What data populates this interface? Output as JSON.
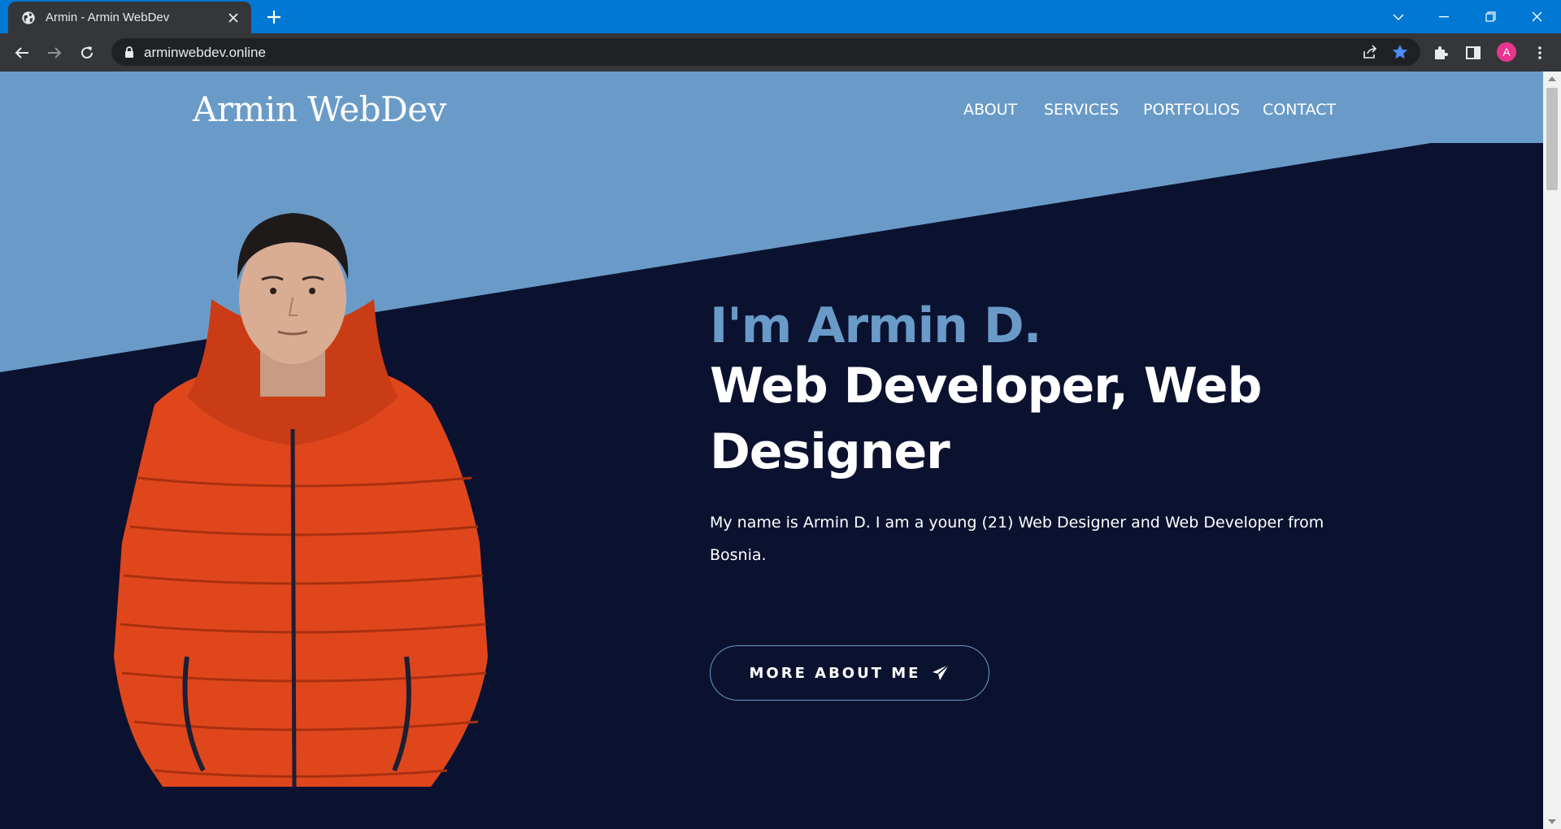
{
  "browser": {
    "tab_title": "Armin - Armin WebDev",
    "url": "arminwebdev.online",
    "profile_initial": "A",
    "accent_color": "#0078d4"
  },
  "site": {
    "logo": "Armin WebDev",
    "nav": [
      "ABOUT",
      "SERVICES",
      "PORTFOLIOS",
      "CONTACT"
    ]
  },
  "hero": {
    "greeting": "I'm Armin D.",
    "headline": "Web Developer, Web Designer",
    "intro": "My name is Armin D. I am a young (21) Web Designer and Web Developer from Bosnia.",
    "cta_label": "MORE ABOUT ME"
  },
  "colors": {
    "hero_light": "#6a9bc8",
    "hero_dark": "#0b1230",
    "jacket": "#e0461c"
  },
  "icons": [
    "globe-icon",
    "close-icon",
    "plus-icon",
    "back-icon",
    "forward-icon",
    "reload-icon",
    "lock-icon",
    "share-icon",
    "star-icon",
    "extensions-icon",
    "sidepanel-icon",
    "kebab-menu-icon",
    "send-icon"
  ]
}
